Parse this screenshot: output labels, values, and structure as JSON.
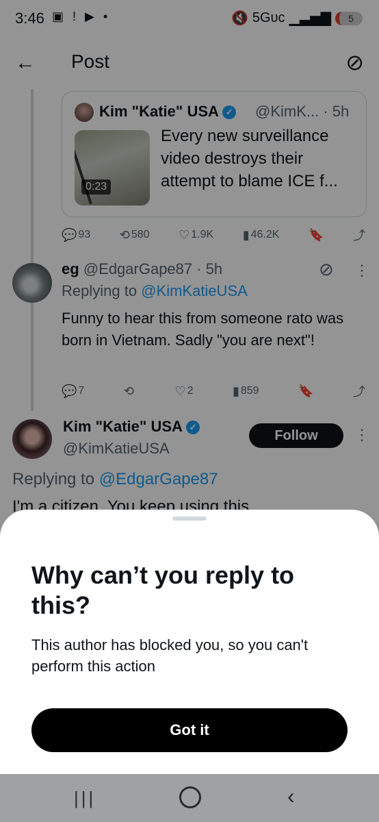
{
  "status_bar": {
    "time": "3:46",
    "left_icons": "▣ ! ▶ •",
    "network": "5Gᴜᴄ",
    "battery": "5"
  },
  "header": {
    "title": "Post"
  },
  "quoted_post": {
    "author_name": "Kim \"Katie\" USA",
    "handle_time": "@KimK... · 5h",
    "video_duration": "0:23",
    "text": "Every new surveillance video destroys their attempt to blame ICE f..."
  },
  "quoted_actions": {
    "replies": "93",
    "reposts": "580",
    "likes": "1.9K",
    "views": "46.2K"
  },
  "reply": {
    "name": "eg",
    "handle_time": "@EdgarGape87 · 5h",
    "replying_prefix": "Replying to ",
    "replying_handle": "@KimKatieUSA",
    "text": "Funny to hear this from someone rato was born in Vietnam. Sadly \"you are next\"!"
  },
  "reply_actions": {
    "replies": "7",
    "reposts": "",
    "likes": "2",
    "views": "859"
  },
  "main_post": {
    "name": "Kim \"Katie\" USA",
    "handle": "@KimKatieUSA",
    "follow_label": "Follow",
    "replying_prefix": "Replying to ",
    "replying_handle": "@EdgarGape87",
    "text_partial": "I'm a citizen. You keep using this"
  },
  "sheet": {
    "title": "Why can’t you reply to this?",
    "body": "This author has blocked you, so you can't perform this action",
    "button": "Got it"
  },
  "colors": {
    "link": "#1d9bf0",
    "verified": "#1d9bf0",
    "overlay": "rgba(0,0,0,0.42)"
  }
}
